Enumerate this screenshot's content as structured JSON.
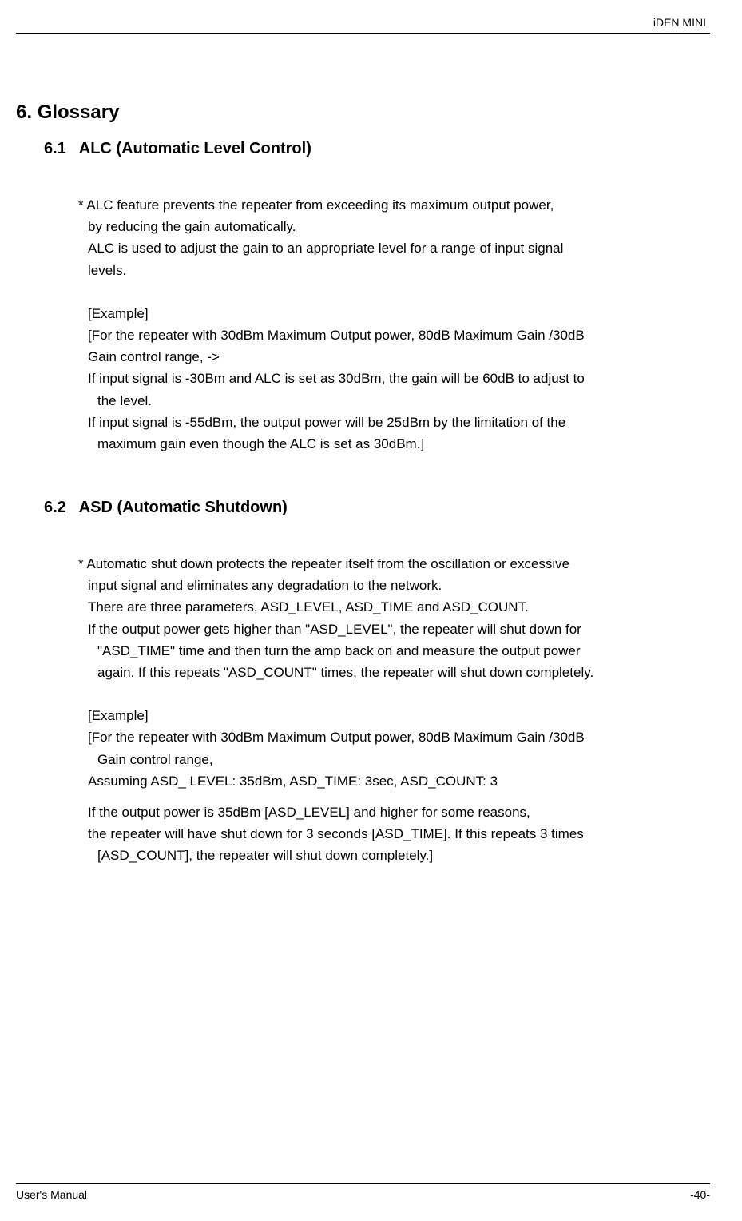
{
  "header": {
    "title": "iDEN MINI"
  },
  "section": {
    "number": "6.",
    "title": "Glossary"
  },
  "subsection1": {
    "number": "6.1",
    "title": "ALC (Automatic Level Control)",
    "p1": "* ALC feature prevents the repeater from exceeding its maximum output power,",
    "p2": "by reducing the gain automatically.",
    "p3": "ALC is used to adjust the gain to an appropriate level for a range of input signal",
    "p4": "levels.",
    "p5": "[Example]",
    "p6": "[For the repeater with 30dBm Maximum Output power, 80dB Maximum Gain /30dB",
    "p7": "Gain control range, ->",
    "p8": "If input signal is -30Bm and ALC is set as 30dBm, the gain will be 60dB to adjust to",
    "p9": "the level.",
    "p10": "If input signal is -55dBm, the output power will be 25dBm by the limitation of the",
    "p11": "maximum gain even though the ALC is set as 30dBm.]"
  },
  "subsection2": {
    "number": "6.2",
    "title": "ASD (Automatic Shutdown)",
    "p1": "* Automatic shut down protects the repeater itself from the oscillation or excessive",
    "p2": "input signal and eliminates any degradation to the network.",
    "p3": "There are three parameters, ASD_LEVEL, ASD_TIME and ASD_COUNT.",
    "p4": "If the output power gets higher than \"ASD_LEVEL\", the repeater will shut down for",
    "p5": "\"ASD_TIME\" time and then turn the amp back on and measure the output power",
    "p6": "again. If this repeats \"ASD_COUNT\" times, the repeater will shut down completely.",
    "p7": "[Example]",
    "p8": "[For the repeater with 30dBm Maximum Output power, 80dB Maximum Gain /30dB",
    "p9": "Gain control range,",
    "p10": "Assuming ASD_ LEVEL: 35dBm, ASD_TIME: 3sec, ASD_COUNT: 3",
    "p11": "If the output power is 35dBm [ASD_LEVEL] and higher for some reasons,",
    "p12": "the repeater will have shut down for 3 seconds [ASD_TIME]. If this repeats 3 times",
    "p13": "[ASD_COUNT], the repeater will shut down completely.]"
  },
  "footer": {
    "left": "User's Manual",
    "right": "-40-"
  }
}
